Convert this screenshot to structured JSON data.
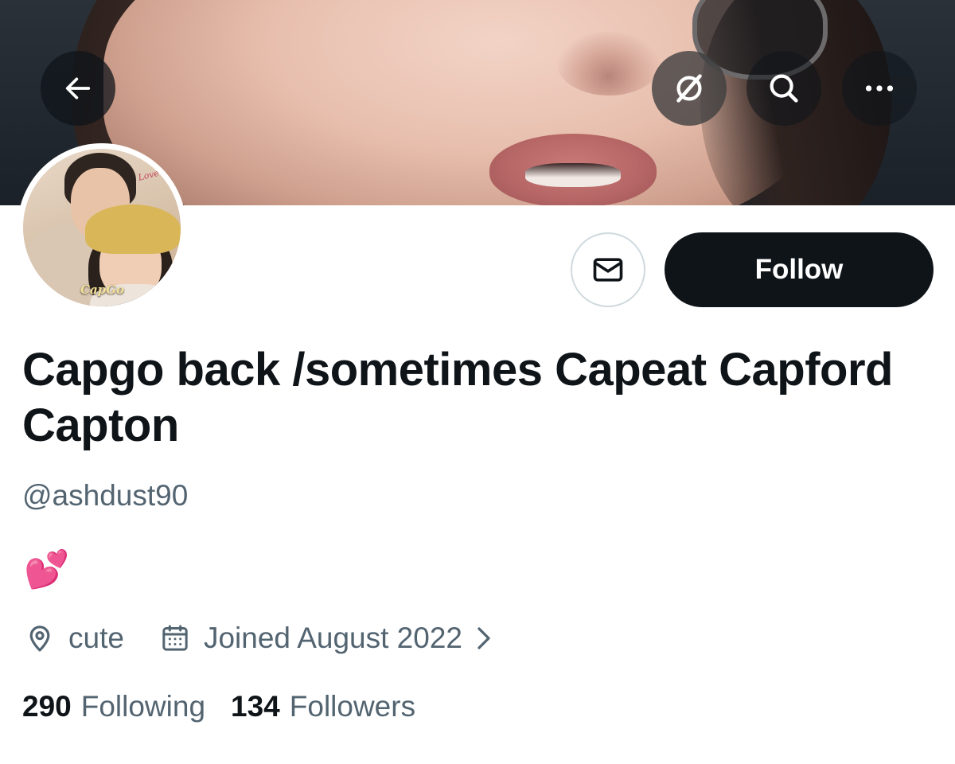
{
  "banner": {
    "icons": {
      "back": "arrow-left-icon",
      "grok": "grok-icon",
      "search": "search-icon",
      "more": "more-horizontal-icon"
    }
  },
  "avatar": {
    "caption": "CapGo",
    "love_text": "Love you"
  },
  "actions": {
    "message_icon": "envelope-icon",
    "follow_label": "Follow"
  },
  "profile": {
    "display_name": "Capgo back /sometimes Capeat Capford Capton",
    "handle": "@ashdust90",
    "bio": "💕",
    "location": "cute",
    "location_icon": "location-pin-icon",
    "joined": "Joined August 2022",
    "joined_icon": "calendar-icon"
  },
  "stats": {
    "following_count": "290",
    "following_label": "Following",
    "followers_count": "134",
    "followers_label": "Followers"
  },
  "colors": {
    "text_primary": "#0f1419",
    "text_secondary": "#536471",
    "follow_button_bg": "#0f1419",
    "border": "#cfd9de"
  }
}
